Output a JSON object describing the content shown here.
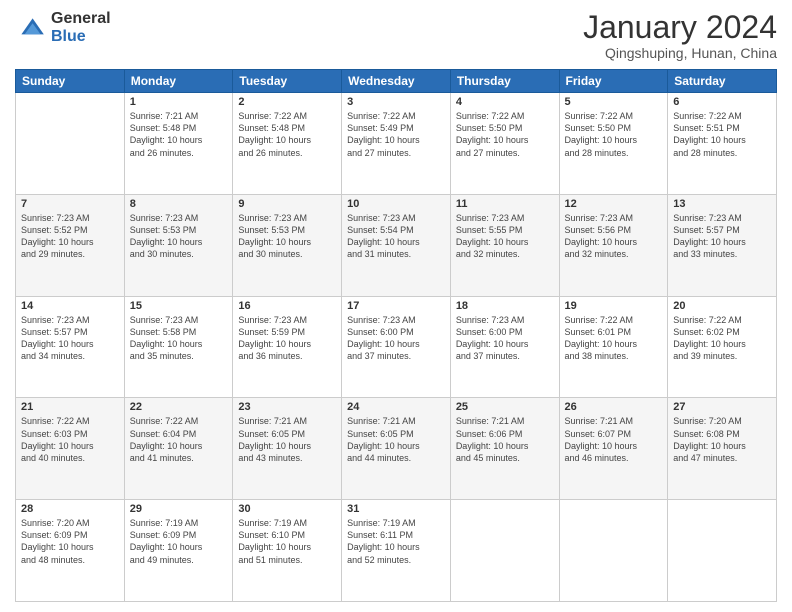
{
  "header": {
    "logo_general": "General",
    "logo_blue": "Blue",
    "month_title": "January 2024",
    "location": "Qingshuping, Hunan, China"
  },
  "days_of_week": [
    "Sunday",
    "Monday",
    "Tuesday",
    "Wednesday",
    "Thursday",
    "Friday",
    "Saturday"
  ],
  "weeks": [
    [
      {
        "day": "",
        "info": ""
      },
      {
        "day": "1",
        "info": "Sunrise: 7:21 AM\nSunset: 5:48 PM\nDaylight: 10 hours\nand 26 minutes."
      },
      {
        "day": "2",
        "info": "Sunrise: 7:22 AM\nSunset: 5:48 PM\nDaylight: 10 hours\nand 26 minutes."
      },
      {
        "day": "3",
        "info": "Sunrise: 7:22 AM\nSunset: 5:49 PM\nDaylight: 10 hours\nand 27 minutes."
      },
      {
        "day": "4",
        "info": "Sunrise: 7:22 AM\nSunset: 5:50 PM\nDaylight: 10 hours\nand 27 minutes."
      },
      {
        "day": "5",
        "info": "Sunrise: 7:22 AM\nSunset: 5:50 PM\nDaylight: 10 hours\nand 28 minutes."
      },
      {
        "day": "6",
        "info": "Sunrise: 7:22 AM\nSunset: 5:51 PM\nDaylight: 10 hours\nand 28 minutes."
      }
    ],
    [
      {
        "day": "7",
        "info": "Sunrise: 7:23 AM\nSunset: 5:52 PM\nDaylight: 10 hours\nand 29 minutes."
      },
      {
        "day": "8",
        "info": "Sunrise: 7:23 AM\nSunset: 5:53 PM\nDaylight: 10 hours\nand 30 minutes."
      },
      {
        "day": "9",
        "info": "Sunrise: 7:23 AM\nSunset: 5:53 PM\nDaylight: 10 hours\nand 30 minutes."
      },
      {
        "day": "10",
        "info": "Sunrise: 7:23 AM\nSunset: 5:54 PM\nDaylight: 10 hours\nand 31 minutes."
      },
      {
        "day": "11",
        "info": "Sunrise: 7:23 AM\nSunset: 5:55 PM\nDaylight: 10 hours\nand 32 minutes."
      },
      {
        "day": "12",
        "info": "Sunrise: 7:23 AM\nSunset: 5:56 PM\nDaylight: 10 hours\nand 32 minutes."
      },
      {
        "day": "13",
        "info": "Sunrise: 7:23 AM\nSunset: 5:57 PM\nDaylight: 10 hours\nand 33 minutes."
      }
    ],
    [
      {
        "day": "14",
        "info": "Sunrise: 7:23 AM\nSunset: 5:57 PM\nDaylight: 10 hours\nand 34 minutes."
      },
      {
        "day": "15",
        "info": "Sunrise: 7:23 AM\nSunset: 5:58 PM\nDaylight: 10 hours\nand 35 minutes."
      },
      {
        "day": "16",
        "info": "Sunrise: 7:23 AM\nSunset: 5:59 PM\nDaylight: 10 hours\nand 36 minutes."
      },
      {
        "day": "17",
        "info": "Sunrise: 7:23 AM\nSunset: 6:00 PM\nDaylight: 10 hours\nand 37 minutes."
      },
      {
        "day": "18",
        "info": "Sunrise: 7:23 AM\nSunset: 6:00 PM\nDaylight: 10 hours\nand 37 minutes."
      },
      {
        "day": "19",
        "info": "Sunrise: 7:22 AM\nSunset: 6:01 PM\nDaylight: 10 hours\nand 38 minutes."
      },
      {
        "day": "20",
        "info": "Sunrise: 7:22 AM\nSunset: 6:02 PM\nDaylight: 10 hours\nand 39 minutes."
      }
    ],
    [
      {
        "day": "21",
        "info": "Sunrise: 7:22 AM\nSunset: 6:03 PM\nDaylight: 10 hours\nand 40 minutes."
      },
      {
        "day": "22",
        "info": "Sunrise: 7:22 AM\nSunset: 6:04 PM\nDaylight: 10 hours\nand 41 minutes."
      },
      {
        "day": "23",
        "info": "Sunrise: 7:21 AM\nSunset: 6:05 PM\nDaylight: 10 hours\nand 43 minutes."
      },
      {
        "day": "24",
        "info": "Sunrise: 7:21 AM\nSunset: 6:05 PM\nDaylight: 10 hours\nand 44 minutes."
      },
      {
        "day": "25",
        "info": "Sunrise: 7:21 AM\nSunset: 6:06 PM\nDaylight: 10 hours\nand 45 minutes."
      },
      {
        "day": "26",
        "info": "Sunrise: 7:21 AM\nSunset: 6:07 PM\nDaylight: 10 hours\nand 46 minutes."
      },
      {
        "day": "27",
        "info": "Sunrise: 7:20 AM\nSunset: 6:08 PM\nDaylight: 10 hours\nand 47 minutes."
      }
    ],
    [
      {
        "day": "28",
        "info": "Sunrise: 7:20 AM\nSunset: 6:09 PM\nDaylight: 10 hours\nand 48 minutes."
      },
      {
        "day": "29",
        "info": "Sunrise: 7:19 AM\nSunset: 6:09 PM\nDaylight: 10 hours\nand 49 minutes."
      },
      {
        "day": "30",
        "info": "Sunrise: 7:19 AM\nSunset: 6:10 PM\nDaylight: 10 hours\nand 51 minutes."
      },
      {
        "day": "31",
        "info": "Sunrise: 7:19 AM\nSunset: 6:11 PM\nDaylight: 10 hours\nand 52 minutes."
      },
      {
        "day": "",
        "info": ""
      },
      {
        "day": "",
        "info": ""
      },
      {
        "day": "",
        "info": ""
      }
    ]
  ]
}
